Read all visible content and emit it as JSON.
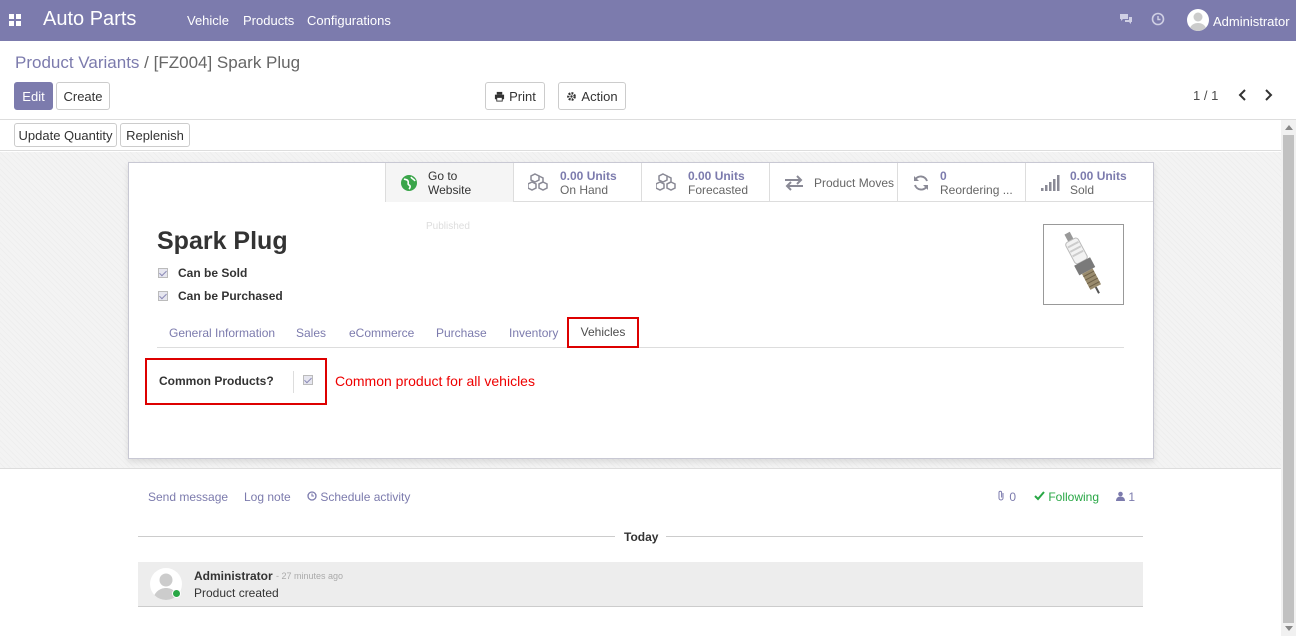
{
  "navbar": {
    "app_name": "Auto Parts",
    "menu": [
      "Vehicle",
      "Products",
      "Configurations"
    ],
    "user": "Administrator"
  },
  "breadcrumb": {
    "parent": "Product Variants",
    "separator": "/",
    "current": "[FZ004] Spark Plug"
  },
  "buttons": {
    "edit": "Edit",
    "create": "Create",
    "print": "Print",
    "action": "Action",
    "update_quantity": "Update Quantity",
    "replenish": "Replenish"
  },
  "pager": "1 / 1",
  "smart_buttons": [
    {
      "value": "Go to",
      "label": "Website",
      "icon": "globe-icon"
    },
    {
      "value": "0.00 Units",
      "label": "On Hand",
      "icon": "cubes-icon"
    },
    {
      "value": "0.00 Units",
      "label": "Forecasted",
      "icon": "cubes-icon"
    },
    {
      "value": "",
      "label": "Product Moves",
      "icon": "exchange-icon"
    },
    {
      "value": "0",
      "label": "Reordering ...",
      "icon": "refresh-icon"
    },
    {
      "value": "0.00 Units",
      "label": "Sold",
      "icon": "signal-icon"
    }
  ],
  "published_label": "Published",
  "product": {
    "name": "Spark Plug",
    "can_be_sold": "Can be Sold",
    "can_be_purchased": "Can be Purchased"
  },
  "tabs": [
    "General Information",
    "Sales",
    "eCommerce",
    "Purchase",
    "Inventory",
    "Vehicles"
  ],
  "active_tab": "Vehicles",
  "vehicles_tab": {
    "field_label": "Common Products?",
    "annotation": "Common product for all vehicles"
  },
  "chatter": {
    "send_message": "Send message",
    "log_note": "Log note",
    "schedule_activity": "Schedule activity",
    "attachments": "0",
    "following": "Following",
    "followers": "1",
    "today": "Today",
    "message": {
      "author": "Administrator",
      "time": "- 27 minutes ago",
      "body": "Product created"
    }
  },
  "colors": {
    "brand": "#7c7bad",
    "annotation_red": "#e00000",
    "following_green": "#28a745"
  }
}
